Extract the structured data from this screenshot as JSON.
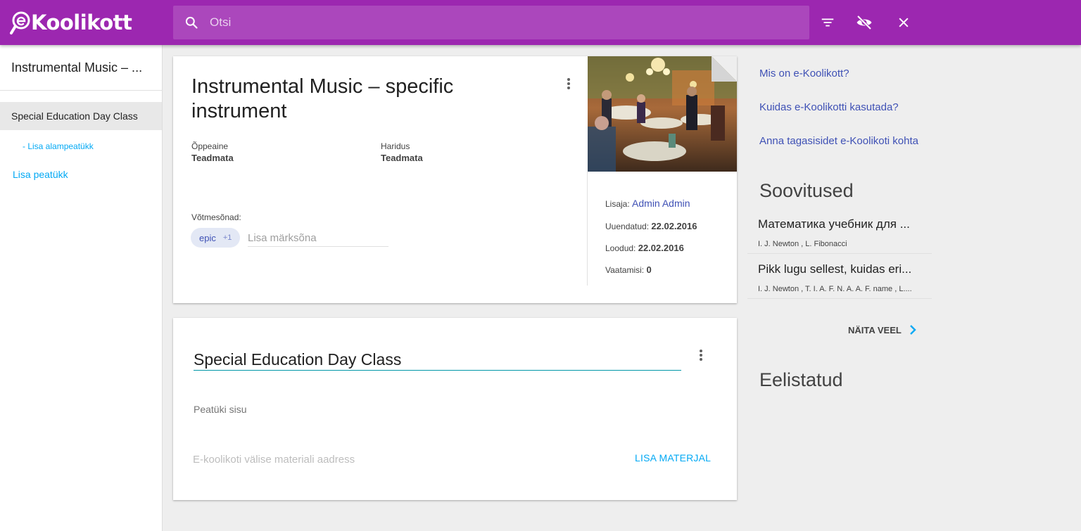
{
  "header": {
    "logo_text": "Koolikott",
    "search_placeholder": "Otsi",
    "icons": [
      "search-icon",
      "filter-icon",
      "visibility-off-icon",
      "close-icon"
    ]
  },
  "sidebar": {
    "title": "Instrumental Music – ...",
    "active_chapter": "Special Education Day Class",
    "add_subchapter": "- Lisa alampeatükk",
    "add_chapter": "Lisa peatükk"
  },
  "material": {
    "title": "Instrumental Music – specific instrument",
    "subject_label": "Õppeaine",
    "subject_value": "Teadmata",
    "education_label": "Haridus",
    "education_value": "Teadmata",
    "keywords_label": "Võtmesõnad:",
    "tag": "epic",
    "tag_more": "+1",
    "keyword_placeholder": "Lisa märksõna",
    "added_by_label": "Lisaja:",
    "added_by": "Admin Admin",
    "updated_label": "Uuendatud:",
    "updated": "22.02.2016",
    "created_label": "Loodud:",
    "created": "22.02.2016",
    "views_label": "Vaatamisi:",
    "views": "0"
  },
  "chapter": {
    "title": "Special Education Day Class",
    "body_placeholder": "Peatüki sisu",
    "url_placeholder": "E-koolikoti välise materiali aadress",
    "add_material": "LISA MATERJAL"
  },
  "right": {
    "links": [
      "Mis on e-Koolikott?",
      "Kuidas e-Koolikotti kasutada?",
      "Anna tagasisidet e-Koolikoti kohta"
    ],
    "recommendations_title": "Soovitused",
    "recommendations": [
      {
        "title": "Математика учебник для ...",
        "authors": "I. J. Newton , L. Fibonacci"
      },
      {
        "title": "Pikk lugu sellest, kuidas eri...",
        "authors": "I. J. Newton , T. I. A. F. N. A. A. F. name , L...."
      }
    ],
    "show_more": "NÄITA VEEL",
    "favorites_title": "Eelistatud"
  },
  "colors": {
    "brand": "#9c27b0",
    "search_bg": "#ab47bc",
    "link": "#3f51b5",
    "accent": "#03a9f4"
  }
}
